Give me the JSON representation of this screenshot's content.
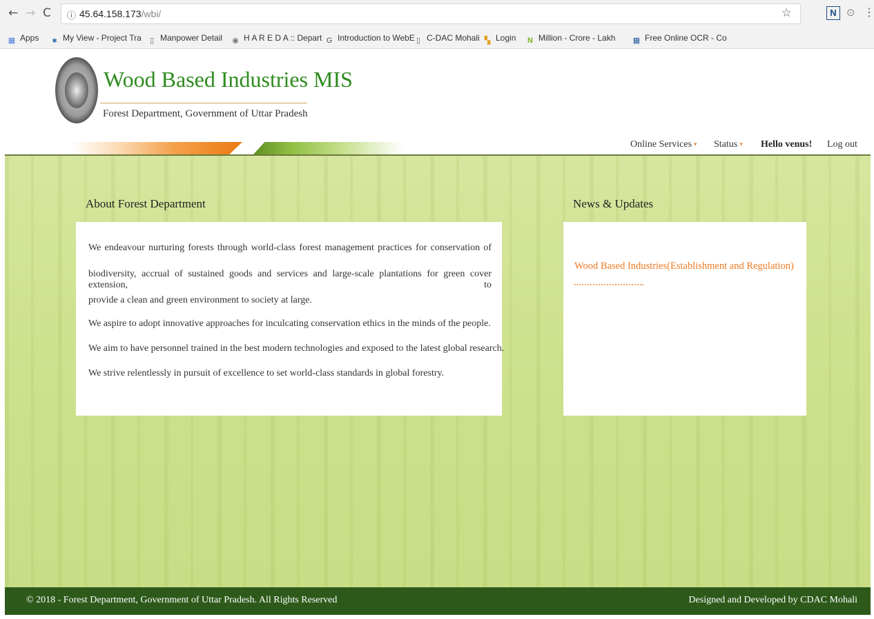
{
  "browser": {
    "url_host": "45.64.158.173",
    "url_path": "/wbi/",
    "bookmarks": [
      {
        "label": "Apps",
        "icon": "apps-grid-icon"
      },
      {
        "label": "My View - Project Tra",
        "icon": "cdac-icon"
      },
      {
        "label": "Manpower Detail",
        "icon": "page-icon"
      },
      {
        "label": "H A R E D A :: Depart",
        "icon": "hareda-icon"
      },
      {
        "label": "Introduction to WebE",
        "icon": "web-icon"
      },
      {
        "label": "C-DAC Mohali",
        "icon": "page-icon"
      },
      {
        "label": "Login",
        "icon": "login-icon"
      },
      {
        "label": "Million - Crore - Lakh",
        "icon": "nc-icon"
      },
      {
        "label": "Free Online OCR - Co",
        "icon": "ocr-icon"
      }
    ]
  },
  "site": {
    "title": "Wood Based Industries MIS",
    "subtitle": "Forest Department, Government of Uttar Pradesh",
    "nav": {
      "online_services": "Online Services",
      "status": "Status",
      "greeting": "Hello venus!",
      "logout": "Log out"
    }
  },
  "about": {
    "heading": "About Forest Department",
    "paragraph_lines": [
      "We endeavour nurturing forests through world-class forest management practices for conservation of",
      "biodiversity, accrual of sustained goods and services and large-scale plantations for green cover extension, to",
      "provide a clean and green environment to society at large."
    ],
    "statements": [
      "We aspire to adopt innovative approaches for inculcating conservation ethics in the minds of the people.",
      "We aim to have personnel trained in the best modern technologies and exposed to the latest global research.",
      "We strive relentlessly in pursuit of excellence to set world-class standards in global forestry."
    ]
  },
  "news": {
    "heading": "News & Updates",
    "items": [
      "Wood Based Industries(Establishment and Regulation)"
    ]
  },
  "footer": {
    "copyright": "© 2018 - Forest Department, Government of Uttar Pradesh.  All Rights Reserved",
    "credit": "Designed and Developed by CDAC Mohali"
  },
  "colors": {
    "title_green": "#2e8b1e",
    "news_orange": "#ee7a22",
    "footer_green": "#2d5a1a",
    "forest_bg": "#cfe28f"
  }
}
